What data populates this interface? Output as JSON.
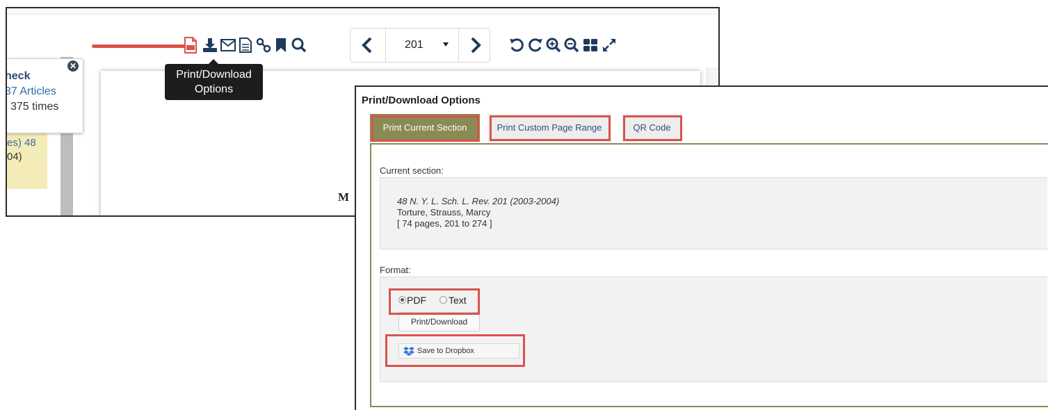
{
  "colors": {
    "accent_tab": "#8a8a54",
    "highlight_red": "#d9534f",
    "toolbar_icon": "#1e3a5c",
    "pdf_icon": "#e0504a",
    "link_blue": "#2f6aa8"
  },
  "viewer": {
    "popup": {
      "line1": "heck",
      "line2": "37 Articles",
      "line3": "l 375 times"
    },
    "side_snippet": {
      "line1": "es) 48",
      "line2": "04)"
    },
    "page_text": "M",
    "toolbar": {
      "icons": [
        "pdf-icon",
        "download-icon",
        "email-icon",
        "document-icon",
        "link-icon",
        "bookmark-icon",
        "search-icon",
        "prev-page-icon",
        "next-page-icon",
        "rotate-left-icon",
        "rotate-right-icon",
        "zoom-in-icon",
        "zoom-out-icon",
        "grid-icon",
        "fullscreen-icon"
      ],
      "page_number": "201"
    },
    "tooltip": {
      "line1": "Print/Download",
      "line2": "Options"
    }
  },
  "dialog": {
    "title": "Print/Download Options",
    "tabs": [
      {
        "label": "Print Current Section",
        "active": true
      },
      {
        "label": "Print Custom Page Range",
        "active": false
      },
      {
        "label": "QR Code",
        "active": false
      }
    ],
    "current_section_label": "Current section:",
    "citation": {
      "title": "48 N. Y. L. Sch. L. Rev. 201 (2003-2004)",
      "authors": "Torture, Strauss, Marcy",
      "pages": "[ 74 pages, 201 to 274 ]"
    },
    "format_label": "Format:",
    "format_options": [
      {
        "label": "PDF",
        "selected": true
      },
      {
        "label": "Text",
        "selected": false
      }
    ],
    "print_button": "Print/Download",
    "dropbox_button": "Save to Dropbox"
  }
}
